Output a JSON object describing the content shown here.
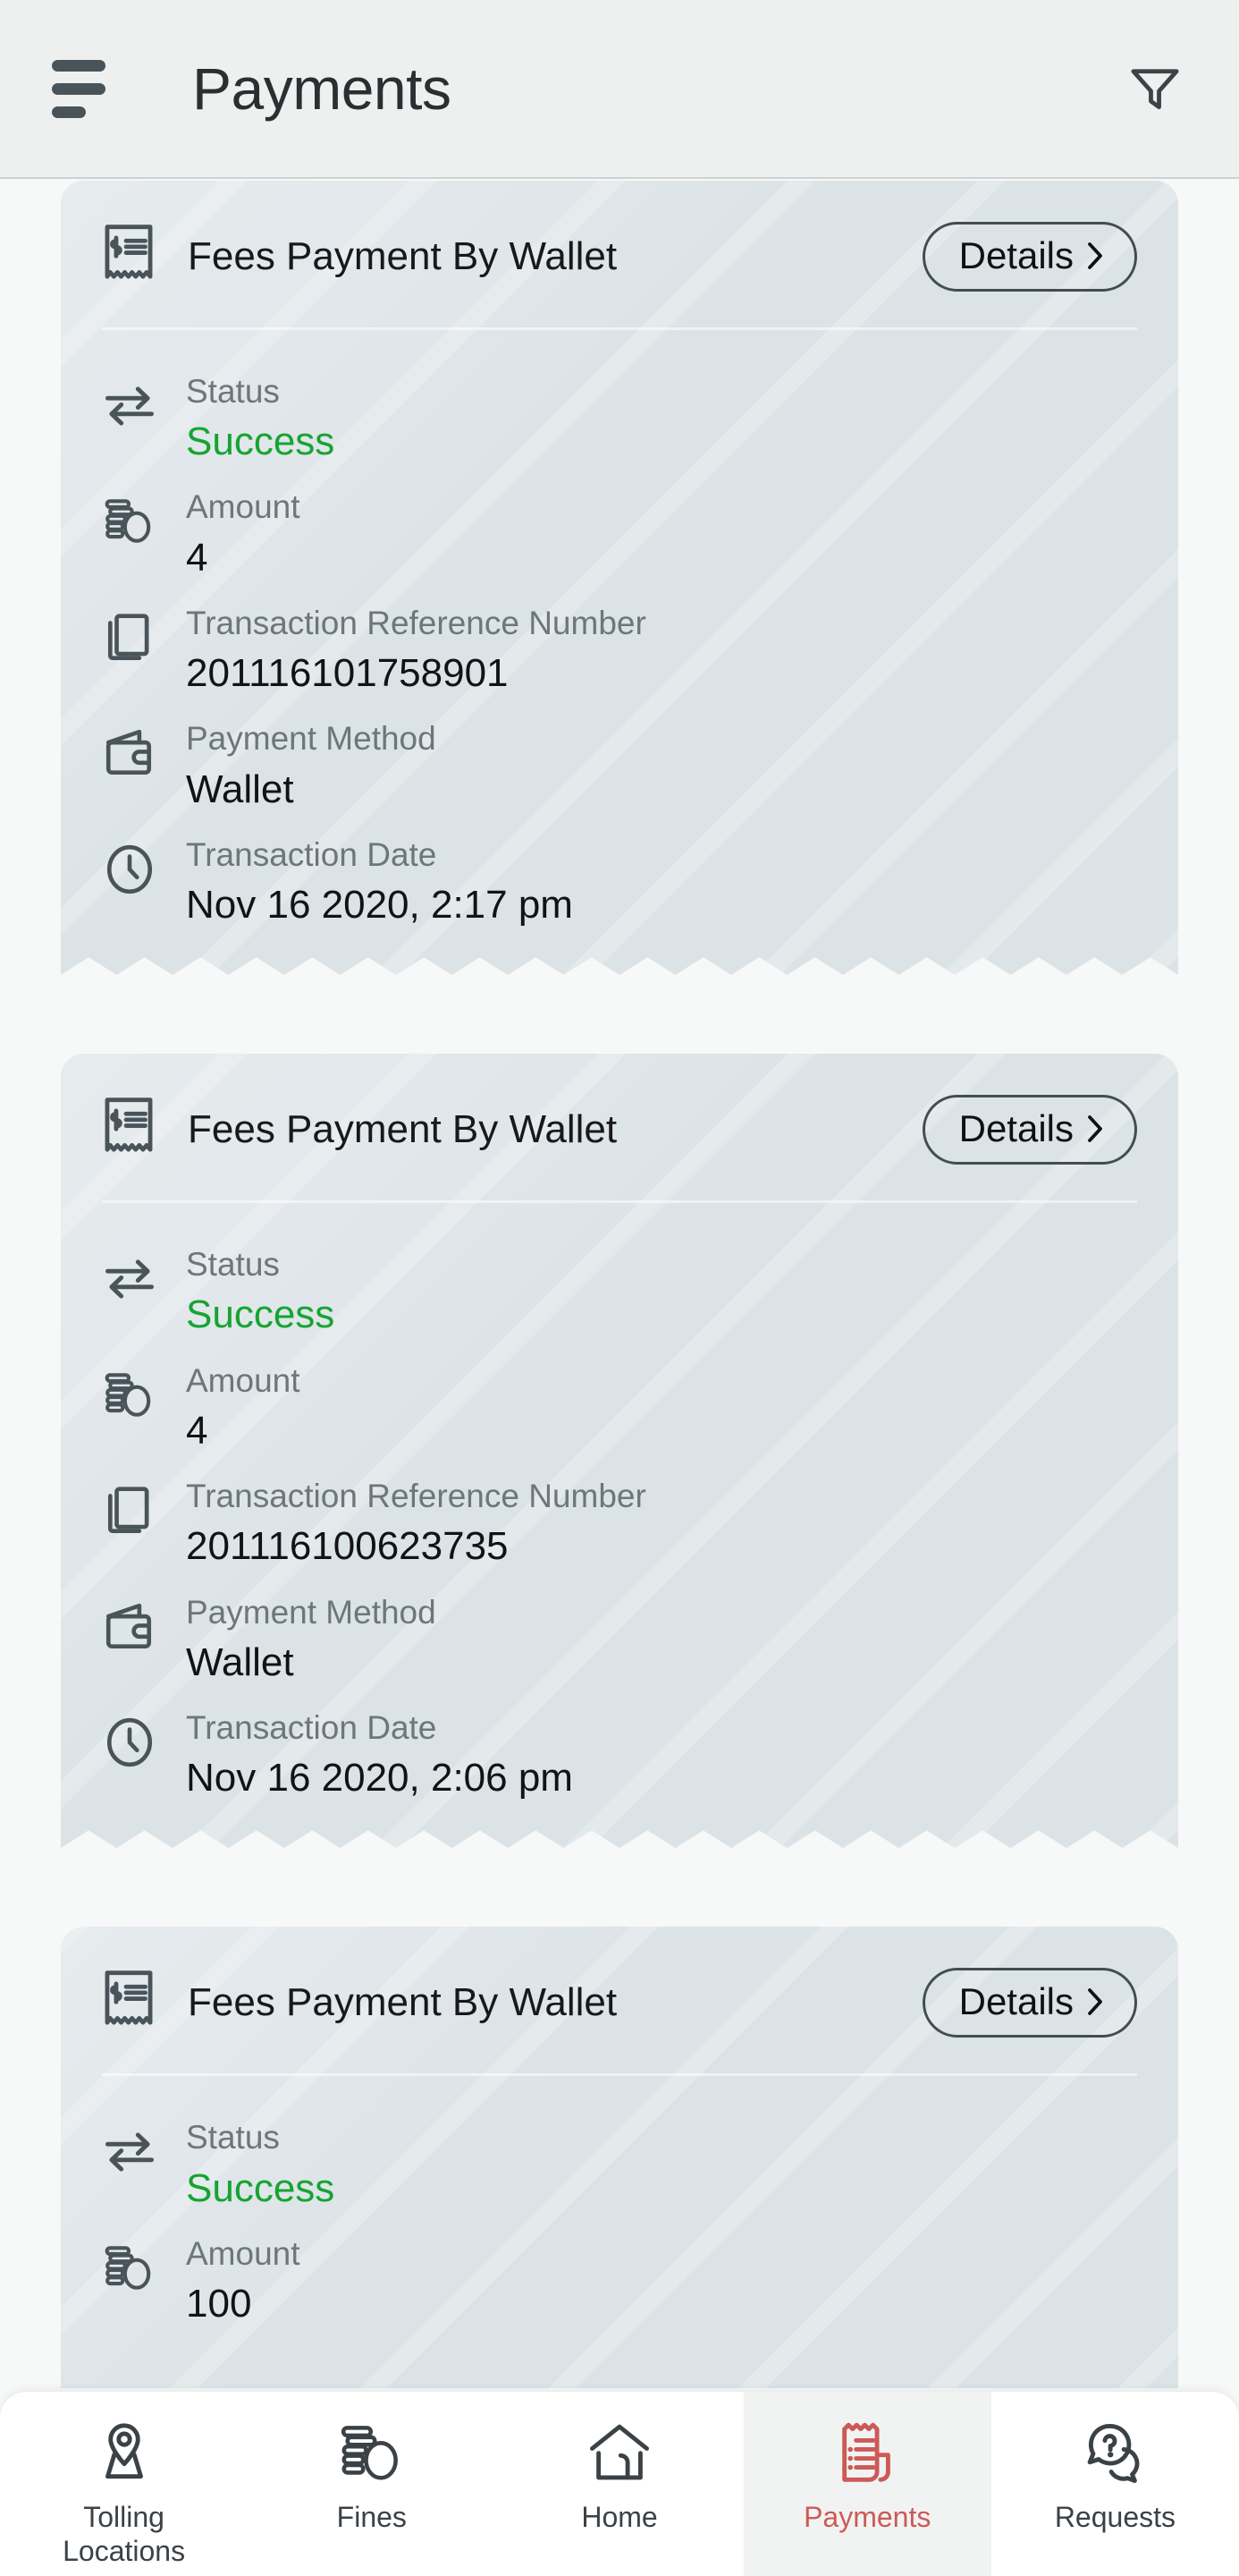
{
  "header": {
    "title": "Payments",
    "menu_icon": "hamburger-menu-icon",
    "filter_icon": "filter-funnel-icon"
  },
  "labels": {
    "status": "Status",
    "amount": "Amount",
    "reference": "Transaction Reference Number",
    "method": "Payment Method",
    "date": "Transaction Date",
    "details": "Details"
  },
  "colors": {
    "success": "#16a431",
    "active_tab": "#cc5a57",
    "card_bg": "#dce3e7",
    "page_bg": "#f7f8f8",
    "header_bg": "#eef0ef"
  },
  "cards": [
    {
      "title": "Fees Payment By Wallet",
      "details_label": "Details",
      "status": "Success",
      "amount": "4",
      "reference": "201116101758901",
      "method": "Wallet",
      "date": "Nov 16 2020, 2:17 pm"
    },
    {
      "title": "Fees Payment By Wallet",
      "details_label": "Details",
      "status": "Success",
      "amount": "4",
      "reference": "201116100623735",
      "method": "Wallet",
      "date": "Nov 16 2020, 2:06 pm"
    },
    {
      "title": "Fees Payment By Wallet",
      "details_label": "Details",
      "status": "Success",
      "amount": "100",
      "reference": "",
      "method": "",
      "date": ""
    }
  ],
  "bottom_nav": {
    "items": [
      {
        "label": "Tolling\nLocations",
        "label_line1": "Tolling",
        "label_line2": "Locations",
        "icon": "map-pin-location-icon",
        "active": false
      },
      {
        "label": "Fines",
        "label_line1": "Fines",
        "label_line2": "",
        "icon": "coins-stack-icon",
        "active": false
      },
      {
        "label": "Home",
        "label_line1": "Home",
        "label_line2": "",
        "icon": "home-house-icon",
        "active": false
      },
      {
        "label": "Payments",
        "label_line1": "Payments",
        "label_line2": "",
        "icon": "receipt-bill-icon",
        "active": true
      },
      {
        "label": "Requests",
        "label_line1": "Requests",
        "label_line2": "",
        "icon": "question-chat-bubbles-icon",
        "active": false
      }
    ]
  }
}
